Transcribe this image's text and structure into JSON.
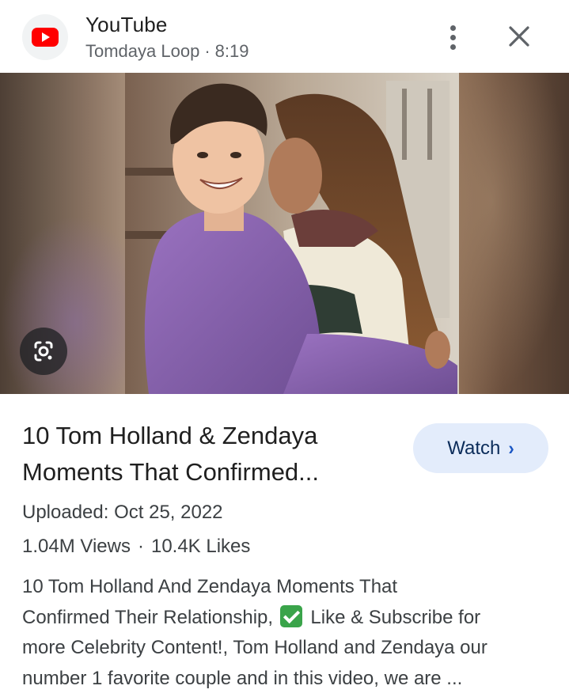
{
  "header": {
    "source_name": "YouTube",
    "channel": "Tomdaya Loop",
    "separator": "·",
    "duration": "8:19",
    "logo_icon": "youtube-logo-icon",
    "more_icon": "more-vert-icon",
    "close_icon": "close-icon"
  },
  "image": {
    "lens_icon": "google-lens-icon"
  },
  "video": {
    "title_line1": "10 Tom Holland & Zendaya",
    "title_line2": "Moments That Confirmed...",
    "watch_label": "Watch",
    "watch_chevron": "›",
    "uploaded": "Uploaded: Oct 25, 2022",
    "views": "1.04M Views",
    "stats_separator": "·",
    "likes": "10.4K Likes",
    "description": {
      "line1": "10 Tom Holland And Zendaya Moments That",
      "line2_before": "Confirmed Their Relationship,",
      "line2_after": "Like & Subscribe for",
      "line3": "more Celebrity Content!, Tom Holland and Zendaya our",
      "line4": "number 1 favorite couple and in this video, we are ..."
    }
  },
  "colors": {
    "youtube_red": "#ff0000",
    "watch_button_bg": "#e3ecfb",
    "watch_chevron": "#1a56c4",
    "secondary_text": "#5f6368",
    "check_emoji": "#3aa44a"
  }
}
